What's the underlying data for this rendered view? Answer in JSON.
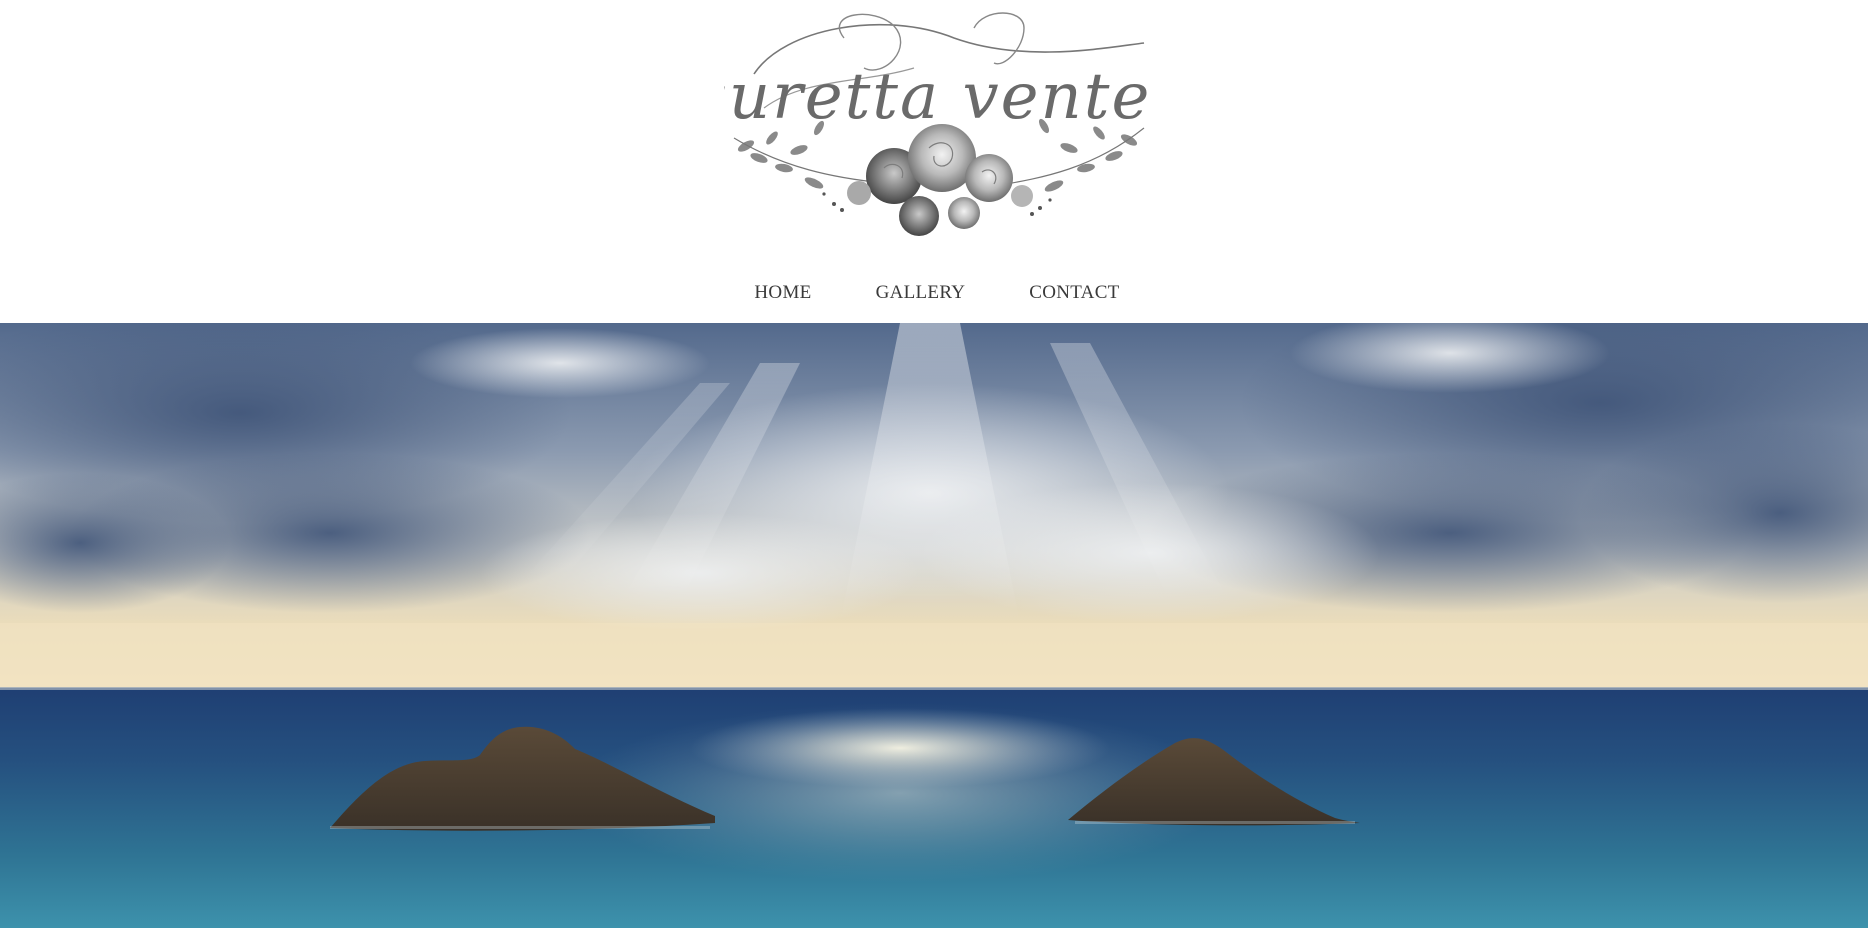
{
  "brand": {
    "logo_text": "suretta venter",
    "logo_icon": "floral-wreath-logo"
  },
  "nav": {
    "items": [
      {
        "label": "HOME"
      },
      {
        "label": "GALLERY"
      },
      {
        "label": "CONTACT"
      }
    ]
  },
  "hero": {
    "image_subject": "sun-rays-over-ocean-islands",
    "colors": {
      "sky_dark": "#4a5f82",
      "sky_light": "#d8dde4",
      "horizon_glow": "#f1dfb8",
      "sea_deep": "#1d4578",
      "sea_teal": "#3a8aa8",
      "island": "#4a3c2e"
    }
  }
}
